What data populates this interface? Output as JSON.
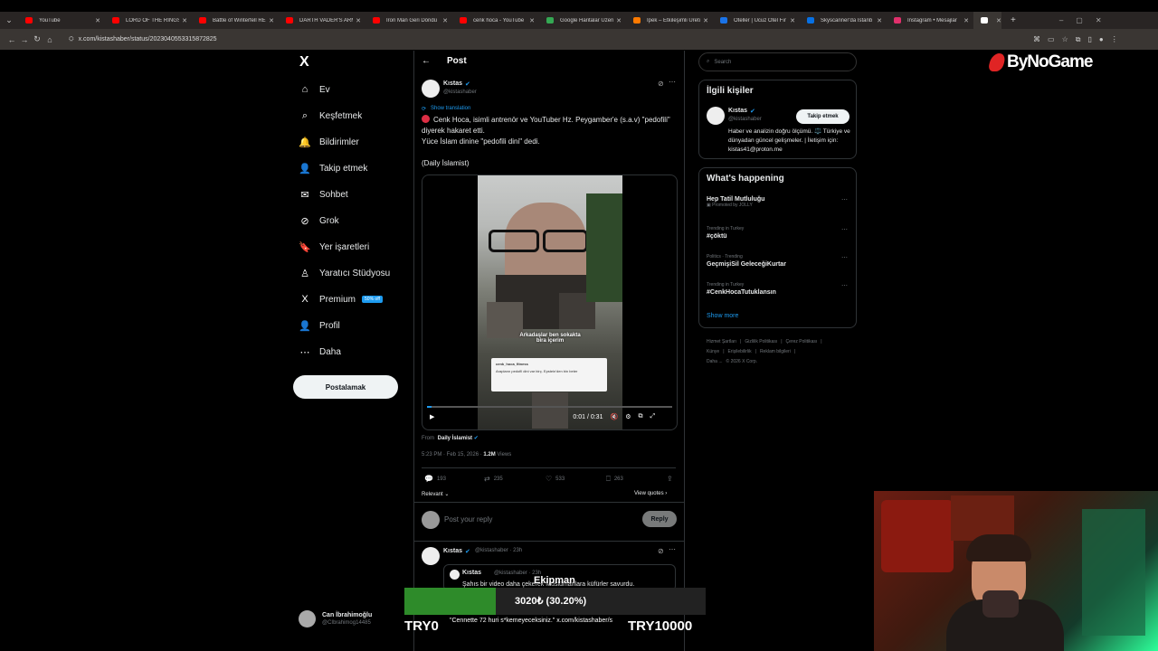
{
  "browser": {
    "tabs": [
      {
        "label": "YouTube",
        "color": "#ff0000"
      },
      {
        "label": "LORD OF THE RINGS",
        "color": "#ff0000"
      },
      {
        "label": "Battle of Winterfell RE",
        "color": "#ff0000"
      },
      {
        "label": "DARTH VADER'S ARMY",
        "color": "#ff0000"
      },
      {
        "label": "Iron Man Geri Döndü",
        "color": "#ff0000"
      },
      {
        "label": "cenk hoca - YouTube",
        "color": "#ff0000"
      },
      {
        "label": "Google Haritalar Üzeri",
        "color": "#34a853"
      },
      {
        "label": "İpek – Etkileşimli Üreti",
        "color": "#ff7a00"
      },
      {
        "label": "Oteller | Ucuz Otel Fır",
        "color": "#1a73e8"
      },
      {
        "label": "Skyscanner'da İstanb",
        "color": "#0770e3"
      },
      {
        "label": "Instagram • Mesajlar",
        "color": "#e1306c"
      },
      {
        "label": "X",
        "color": "#ffffff"
      }
    ],
    "url": "x.com/kistashaber/status/2023040553315872825",
    "new_tab": "+",
    "win_min": "–",
    "win_max": "▢",
    "win_close": "✕"
  },
  "sidebar": {
    "logo": "X",
    "items": [
      {
        "label": "Ev",
        "icon": "home-icon",
        "glyph": "⌂"
      },
      {
        "label": "Keşfetmek",
        "icon": "search-icon",
        "glyph": "⌕"
      },
      {
        "label": "Bildirimler",
        "icon": "bell-icon",
        "glyph": "🔔"
      },
      {
        "label": "Takip etmek",
        "icon": "person-add-icon",
        "glyph": "👤"
      },
      {
        "label": "Sohbet",
        "icon": "mail-icon",
        "glyph": "✉"
      },
      {
        "label": "Grok",
        "icon": "grok-icon",
        "glyph": "⊘"
      },
      {
        "label": "Yer işaretleri",
        "icon": "bookmark-icon",
        "glyph": "🔖"
      },
      {
        "label": "Yaratıcı Stüdyosu",
        "icon": "creator-icon",
        "glyph": "♙"
      },
      {
        "label": "Premium",
        "icon": "x-premium-icon",
        "glyph": "X",
        "badge": "50% off"
      },
      {
        "label": "Profil",
        "icon": "profile-icon",
        "glyph": "👤"
      },
      {
        "label": "Daha",
        "icon": "more-icon",
        "glyph": "⋯"
      }
    ],
    "post_button": "Postalamak",
    "account": {
      "name": "Can İbrahimoğlu",
      "handle": "@CIbrahimog14485"
    }
  },
  "main": {
    "header": {
      "back": "←",
      "title": "Post"
    },
    "tweet": {
      "author": "Kıstas",
      "handle": "@kistashaber",
      "show_translation": "Show translation",
      "line1": "Cenk Hoca, isimli antrenör ve YouTuber Hz. Peygamber'e (s.a.v) \"pedofili\" diyerek hakaret etti.",
      "line2": "Yüce İslam dinine \"pedofili dini\" dedi.",
      "line3": "(Daily İslamist)",
      "video": {
        "caption_line1": "Arkadaşlar ben sokakta",
        "caption_line2": "bira içerim",
        "card_user": "cenk_hoca_fitness",
        "card_text": "Arapların pedofil dini var birç. Epstein'den bin beter",
        "time": "0:01 / 0:31"
      },
      "from_label": "From",
      "from_source": "Daily İslamist",
      "timestamp": "5:23 PM · Feb 15, 2026 ·",
      "views_count": "1.2M",
      "views_label": "Views",
      "replies": "193",
      "reposts": "235",
      "likes": "533",
      "bookmarks": "263",
      "relevant": "Relevant ⌄",
      "view_quotes": "View quotes ›"
    },
    "reply_placeholder": "Post your reply",
    "reply_button": "Reply",
    "next_tweet": {
      "author": "Kıstas",
      "handle": "@kistashaber · 23h",
      "quoted_author": "Kıstas",
      "quoted_handle": "@kistashaber · 23h",
      "quoted_text": "Şahıs bir video daha çekerek Müslümanlara küfürler savurdu."
    }
  },
  "right": {
    "search_placeholder": "Search",
    "related": {
      "title": "İlgili kişiler",
      "name": "Kıstas",
      "handle": "@kistashaber",
      "follow": "Takip etmek",
      "bio": "Haber ve analizin doğru ölçümü. ⚖️ Türkiye ve dünyadan güncel gelişmeler. | İletişim için: kistas41@proton.me"
    },
    "happening": {
      "title": "What's happening",
      "trends": [
        {
          "meta": "Promoted by JOLLY",
          "name": "Hep Tatil Mutluluğu",
          "promoted": true
        },
        {
          "meta": "Trending in Turkey",
          "name": "#çöktü"
        },
        {
          "meta": "Politics · Trending",
          "name": "GeçmişiSil GeleceğiKurtar"
        },
        {
          "meta": "Trending in Turkey",
          "name": "#CenkHocaTutuklansın"
        }
      ],
      "show_more": "Show more"
    },
    "footer": [
      "Hizmet Şartları",
      "|",
      "Gizlilik Politikası",
      "|",
      "Çerez Politikası",
      "|",
      "Künye",
      "|",
      "Erişilebilirlik",
      "|",
      "Reklam bilgileri",
      "|",
      "Daha ...",
      "© 2026 X Corp."
    ]
  },
  "overlay": {
    "brand": "ByNoGame",
    "donation_label": "Ekipman",
    "donation_amount": "3020₺ (30.20%)",
    "donation_progress": 0.302,
    "goal_min": "TRY0",
    "goal_max": "TRY10000",
    "ticker": "\"Cennette 72 huri s*kemeyeceksiniz.\" x.com/kistashaber/s",
    "colors": {
      "progress": "#2e8b2a",
      "brand_red": "#e02424"
    }
  }
}
